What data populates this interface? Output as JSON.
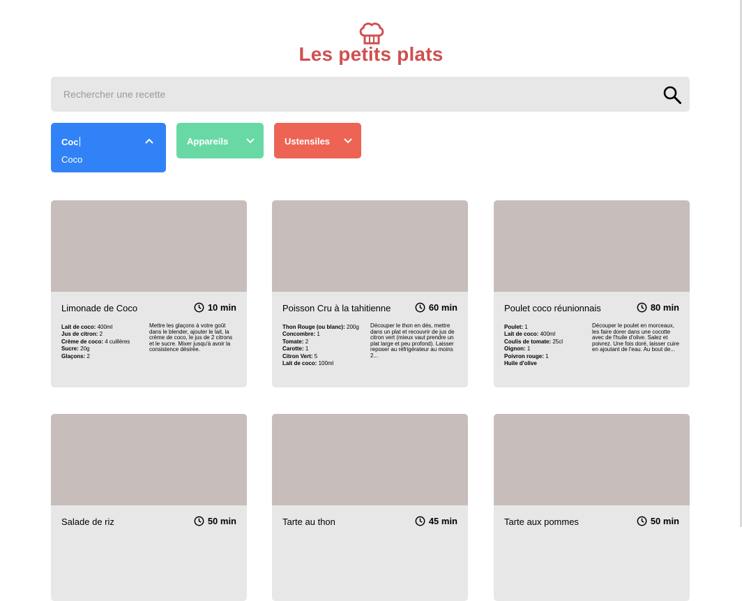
{
  "header": {
    "brand": "Les petits plats",
    "logo_icon": "chef-hat-icon"
  },
  "search": {
    "placeholder": "Rechercher une recette",
    "value": ""
  },
  "filters": {
    "ingredients": {
      "typed": "Coc",
      "options": [
        "Coco"
      ],
      "color": "#3282f7"
    },
    "appareils": {
      "label": "Appareils",
      "color": "#68d9a4"
    },
    "ustensiles": {
      "label": "Ustensiles",
      "color": "#ed6454"
    }
  },
  "colors": {
    "brand": "#d04f4f",
    "card_bg": "#e7e7e7",
    "image_placeholder": "#c7bebb"
  },
  "recipes": [
    {
      "name": "Limonade de Coco",
      "time": "10 min",
      "ingredients": [
        {
          "name": "Lait de coco:",
          "qty": "400ml"
        },
        {
          "name": "Jus de citron:",
          "qty": "2"
        },
        {
          "name": "Crème de coco:",
          "qty": "4 cuillères"
        },
        {
          "name": "Sucre:",
          "qty": "20g"
        },
        {
          "name": "Glaçons:",
          "qty": "2"
        }
      ],
      "description": "Mettre les glaçons à votre goût dans le blender, ajouter le lait, la crème de coco, le jus de 2 citrons et le sucre. Mixer jusqu'à avoir la consistence désirée."
    },
    {
      "name": "Poisson Cru à la tahitienne",
      "time": "60 min",
      "ingredients": [
        {
          "name": "Thon Rouge (ou blanc):",
          "qty": "200g"
        },
        {
          "name": "Concombre:",
          "qty": "1"
        },
        {
          "name": "Tomate:",
          "qty": "2"
        },
        {
          "name": "Carotte:",
          "qty": "1"
        },
        {
          "name": "Citron Vert:",
          "qty": "5"
        },
        {
          "name": "Lait de coco:",
          "qty": "100ml"
        }
      ],
      "description": "Découper le thon en dés, mettre dans un plat et recouvrir de jus de citron vert (mieux vaut prendre un plat large et peu profond). Laisser reposer au réfrigérateur au moins 2..."
    },
    {
      "name": "Poulet coco réunionnais",
      "time": "80 min",
      "ingredients": [
        {
          "name": "Poulet:",
          "qty": "1"
        },
        {
          "name": "Lait de coco:",
          "qty": "400ml"
        },
        {
          "name": "Coulis de tomate:",
          "qty": "25cl"
        },
        {
          "name": "Oignon:",
          "qty": "1"
        },
        {
          "name": "Poivron rouge:",
          "qty": "1"
        },
        {
          "name": "Huile d'olive",
          "qty": ""
        }
      ],
      "description": "Découper le poulet en morceaux, les faire dorer dans une cocotte avec de l'huile d'olive. Salez et poivrez. Une fois doré, laisser cuire en ajoutant de l'eau. Au bout de..."
    },
    {
      "name": "Salade de riz",
      "time": "50 min",
      "ingredients": [],
      "description": ""
    },
    {
      "name": "Tarte au thon",
      "time": "45 min",
      "ingredients": [],
      "description": ""
    },
    {
      "name": "Tarte aux pommes",
      "time": "50 min",
      "ingredients": [],
      "description": ""
    }
  ]
}
